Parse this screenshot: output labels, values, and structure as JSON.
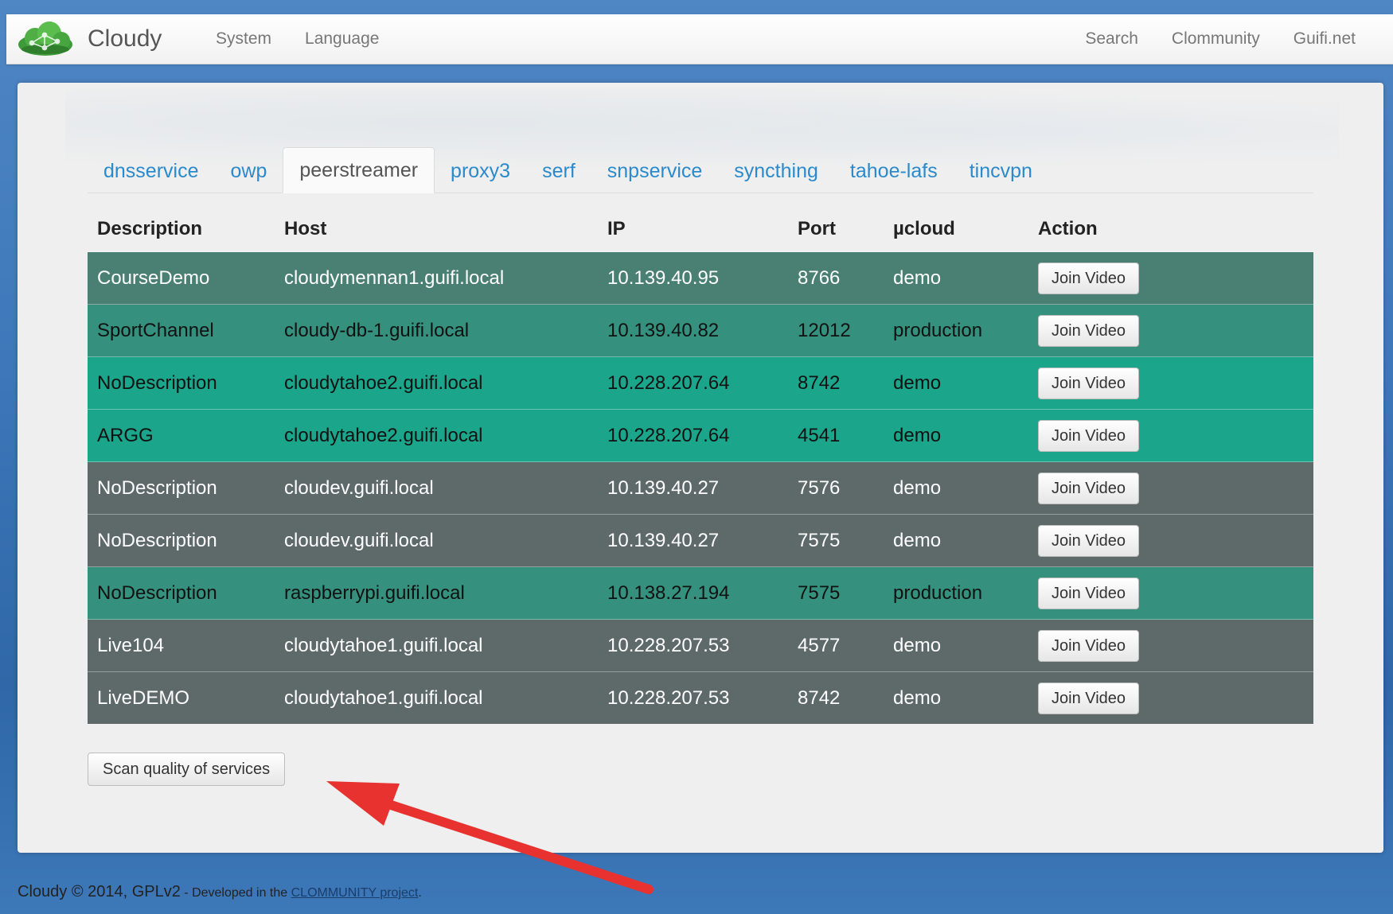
{
  "navbar": {
    "brand": "Cloudy",
    "left_links": [
      "System",
      "Language"
    ],
    "right_links": [
      "Search",
      "Clommunity",
      "Guifi.net"
    ]
  },
  "tabs": [
    {
      "label": "dnsservice"
    },
    {
      "label": "owp"
    },
    {
      "label": "peerstreamer",
      "active": true
    },
    {
      "label": "proxy3"
    },
    {
      "label": "serf"
    },
    {
      "label": "snpservice"
    },
    {
      "label": "syncthing"
    },
    {
      "label": "tahoe-lafs"
    },
    {
      "label": "tincvpn"
    }
  ],
  "table": {
    "headers": [
      "Description",
      "Host",
      "IP",
      "Port",
      "µcloud",
      "Action"
    ],
    "rows": [
      {
        "description": "CourseDemo",
        "host": "cloudymennan1.guifi.local",
        "ip": "10.139.40.95",
        "port": "8766",
        "ucloud": "demo",
        "action": "Join Video",
        "style": "green"
      },
      {
        "description": "SportChannel",
        "host": "cloudy-db-1.guifi.local",
        "ip": "10.139.40.82",
        "port": "12012",
        "ucloud": "production",
        "action": "Join Video",
        "style": "mid"
      },
      {
        "description": "NoDescription",
        "host": "cloudytahoe2.guifi.local",
        "ip": "10.228.207.64",
        "port": "8742",
        "ucloud": "demo",
        "action": "Join Video",
        "style": "teal"
      },
      {
        "description": "ARGG",
        "host": "cloudytahoe2.guifi.local",
        "ip": "10.228.207.64",
        "port": "4541",
        "ucloud": "demo",
        "action": "Join Video",
        "style": "teal"
      },
      {
        "description": "NoDescription",
        "host": "cloudev.guifi.local",
        "ip": "10.139.40.27",
        "port": "7576",
        "ucloud": "demo",
        "action": "Join Video",
        "style": "grey"
      },
      {
        "description": "NoDescription",
        "host": "cloudev.guifi.local",
        "ip": "10.139.40.27",
        "port": "7575",
        "ucloud": "demo",
        "action": "Join Video",
        "style": "grey"
      },
      {
        "description": "NoDescription",
        "host": "raspberrypi.guifi.local",
        "ip": "10.138.27.194",
        "port": "7575",
        "ucloud": "production",
        "action": "Join Video",
        "style": "mid"
      },
      {
        "description": "Live104",
        "host": "cloudytahoe1.guifi.local",
        "ip": "10.228.207.53",
        "port": "4577",
        "ucloud": "demo",
        "action": "Join Video",
        "style": "grey"
      },
      {
        "description": "LiveDEMO",
        "host": "cloudytahoe1.guifi.local",
        "ip": "10.228.207.53",
        "port": "8742",
        "ucloud": "demo",
        "action": "Join Video",
        "style": "grey"
      }
    ]
  },
  "scan_button": "Scan quality of services",
  "footer": {
    "main": "Cloudy © 2014, GPLv2",
    "developed": " - Developed in the ",
    "link": "CLOMMUNITY project",
    "end": "."
  },
  "colors": {
    "row_green": "#4a7f73",
    "row_mid": "#35917e",
    "row_teal": "#1ba68b",
    "row_grey": "#5e6a6a",
    "link": "#2a8acb",
    "arrow": "#e8322f"
  },
  "icons": {
    "brand": "cloud-logo-icon"
  }
}
